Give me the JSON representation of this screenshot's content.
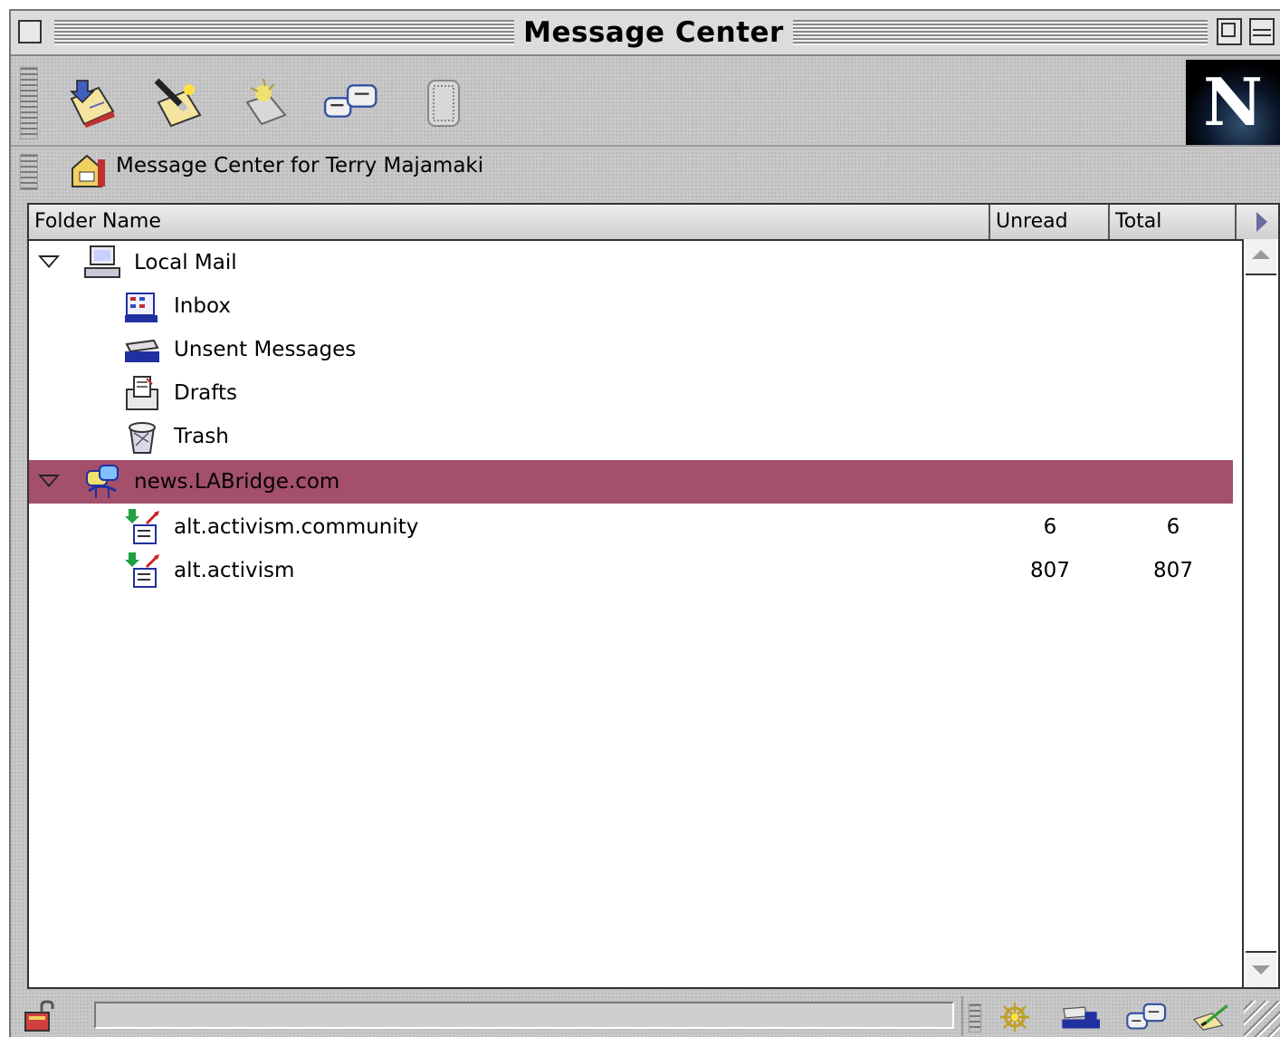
{
  "window": {
    "title": "Message Center"
  },
  "toolbar": {
    "items": [
      {
        "icon": "get-messages-icon"
      },
      {
        "icon": "new-message-icon"
      },
      {
        "icon": "new-folder-icon"
      },
      {
        "icon": "join-groups-icon"
      },
      {
        "icon": "stop-icon"
      }
    ],
    "logo": "N"
  },
  "location": {
    "text": "Message Center for Terry Majamaki"
  },
  "columns": {
    "folder_name": "Folder Name",
    "unread": "Unread",
    "total": "Total"
  },
  "folders": [
    {
      "label": "Local Mail",
      "icon": "local-mail-icon",
      "unread": "",
      "total": ""
    },
    {
      "label": "Inbox",
      "icon": "inbox-icon",
      "unread": "",
      "total": ""
    },
    {
      "label": "Unsent Messages",
      "icon": "unsent-messages-icon",
      "unread": "",
      "total": ""
    },
    {
      "label": "Drafts",
      "icon": "drafts-icon",
      "unread": "",
      "total": ""
    },
    {
      "label": "Trash",
      "icon": "trash-icon",
      "unread": "",
      "total": ""
    },
    {
      "label": "news.LABridge.com",
      "icon": "news-server-icon",
      "unread": "",
      "total": ""
    },
    {
      "label": "alt.activism.community",
      "icon": "newsgroup-icon",
      "unread": "6",
      "total": "6"
    },
    {
      "label": "alt.activism",
      "icon": "newsgroup-icon",
      "unread": "807",
      "total": "807"
    }
  ],
  "colors": {
    "selection": "#a4506a",
    "chrome": "#c8c8c8"
  }
}
